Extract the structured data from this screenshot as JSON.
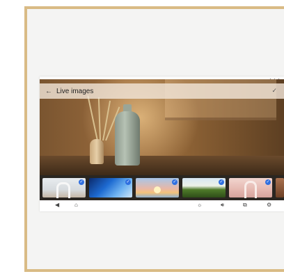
{
  "screen": {
    "status_text": "▪ ▪ ▪",
    "title_bar": {
      "title": "Live images",
      "back_icon": "arrow-left",
      "confirm_icon": "checkmark"
    }
  },
  "thumbnails": [
    {
      "name": "white-arch-room",
      "selected": true
    },
    {
      "name": "blue-wave",
      "selected": true
    },
    {
      "name": "sunset-sea",
      "selected": true
    },
    {
      "name": "green-hedge",
      "selected": true
    },
    {
      "name": "pink-arch",
      "selected": true
    },
    {
      "name": "terracotta-partial",
      "selected": false
    }
  ],
  "navbar": {
    "icons": [
      "back-triangle",
      "home",
      "brightness",
      "volume",
      "screen-mirror",
      "settings-gear"
    ]
  },
  "colors": {
    "frame": "#d9bb85",
    "selected_badge": "#2f6fe0"
  }
}
